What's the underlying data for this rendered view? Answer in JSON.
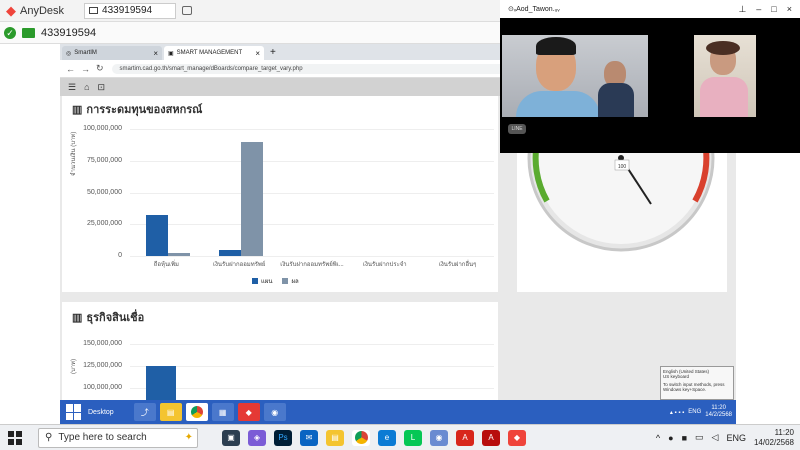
{
  "anydesk": {
    "logo": "◆",
    "app_name": "AnyDesk",
    "tab_id": "433919594",
    "address": "433919594",
    "check_icon": "check-circle-icon"
  },
  "browser": {
    "tabs": [
      {
        "label": "SmartIM"
      },
      {
        "label": "SMART MANAGEMENT"
      }
    ],
    "url": "smartim.cad.go.th/smart_manage/dBoards/compare_target_vary.php"
  },
  "chart1": {
    "title": "การระดมทุนของสหกรณ์",
    "ylabel": "จำนวนเงิน (บาท)",
    "legend": [
      "แผน",
      "ผล"
    ]
  },
  "chart2": {
    "title": "ธุรกิจสินเชื่อ",
    "ylabel": "(บาท)"
  },
  "chart_data": [
    {
      "type": "bar",
      "title": "การระดมทุนของสหกรณ์",
      "ylabel": "จำนวนเงิน (บาท)",
      "categories": [
        "ถือหุ้นเพิ่ม",
        "เงินรับฝากออมทรัพย์",
        "เงินรับฝากออมทรัพย์พิเ...",
        "เงินรับฝากประจำ",
        "เงินรับฝากอื่นๆ"
      ],
      "yticks": [
        "100,000,000",
        "75,000,000",
        "50,000,000",
        "25,000,000",
        "0"
      ],
      "ylim": [
        0,
        100000000
      ],
      "series": [
        {
          "name": "แผน",
          "color": "#1f5fa6",
          "values": [
            32000000,
            5000000,
            0,
            0,
            0
          ]
        },
        {
          "name": "ผล",
          "color": "#7f93a8",
          "values": [
            2000000,
            90000000,
            0,
            0,
            0
          ]
        }
      ]
    },
    {
      "type": "bar",
      "title": "ธุรกิจสินเชื่อ",
      "yticks": [
        "150,000,000",
        "125,000,000",
        "100,000,000"
      ],
      "ylim": [
        0,
        150000000
      ],
      "series": [
        {
          "name": "แผน",
          "color": "#1f5fa6",
          "values": [
            125000000
          ]
        }
      ]
    }
  ],
  "gauge": {
    "center_label": "100"
  },
  "video": {
    "title": "⊙ᵥAod_Tawon.ᵤᵥ",
    "badge": "LINE"
  },
  "remote_taskbar": {
    "desktop_label": "Desktop",
    "lang": "ENG",
    "time": "11:20",
    "date": "14/2/2568",
    "tooltip": [
      "English (United States)",
      "US keyboard",
      "To switch input methods, press",
      "Windows key+Space."
    ]
  },
  "taskbar": {
    "search_placeholder": "Type here to search",
    "lang": "ENG",
    "time": "11:20",
    "date": "14/02/2568"
  }
}
